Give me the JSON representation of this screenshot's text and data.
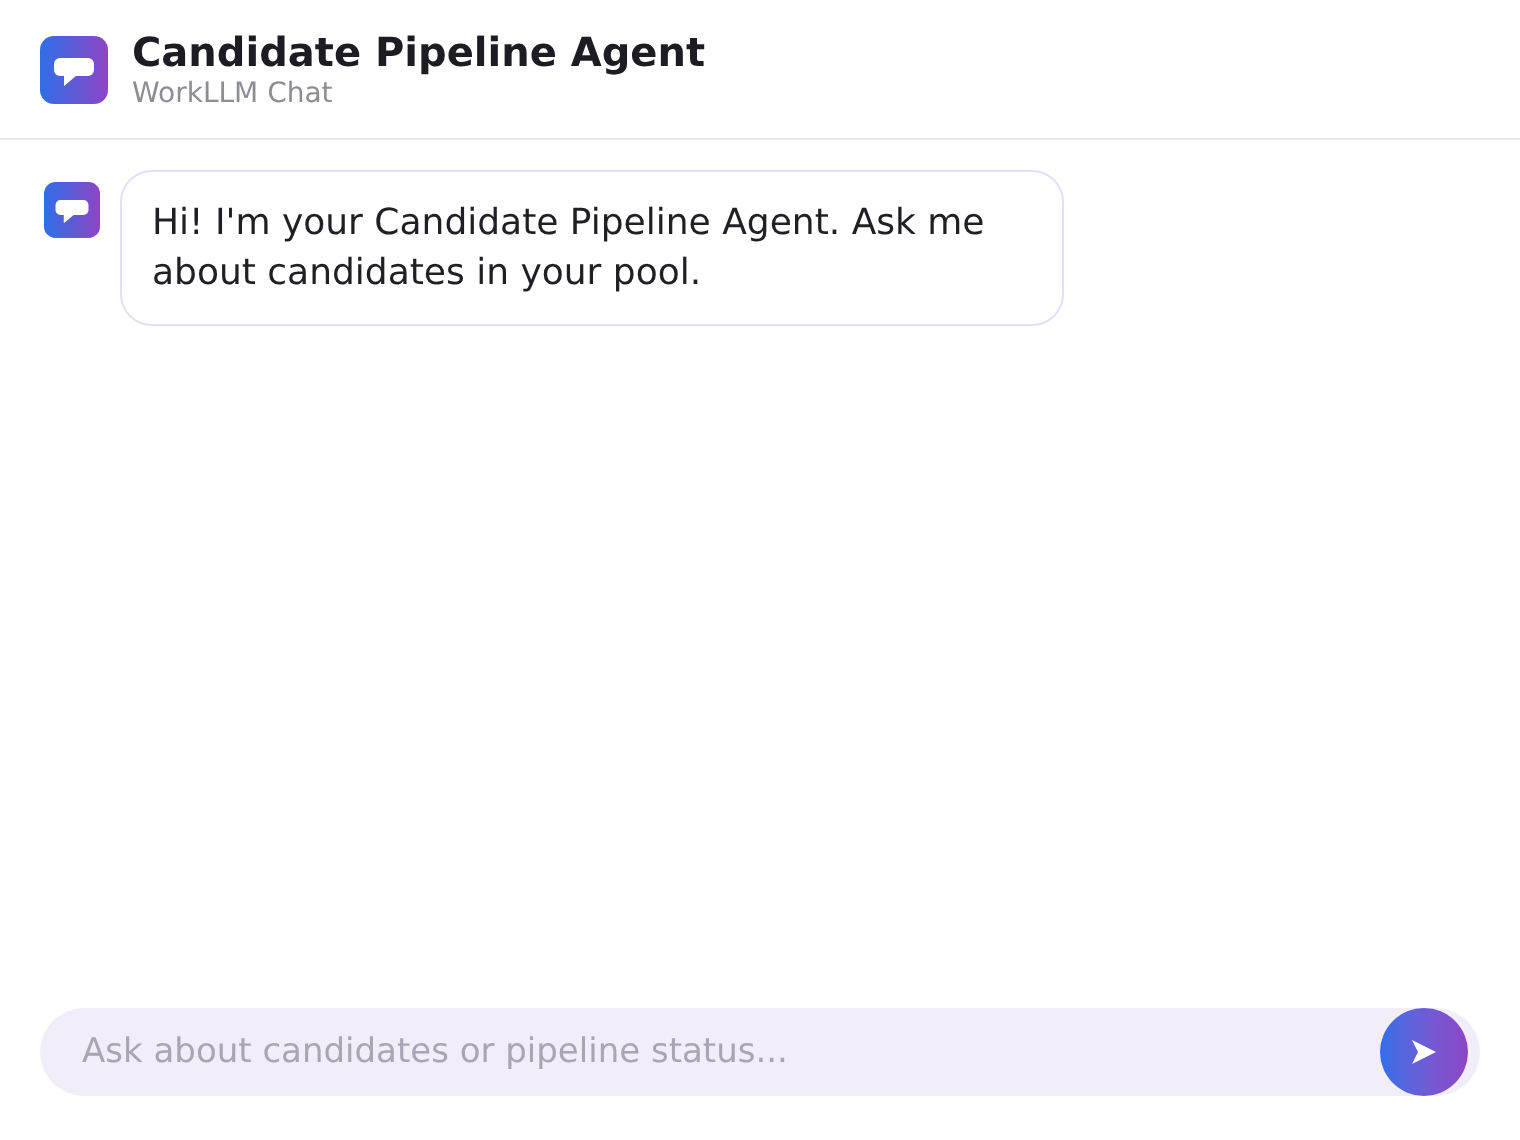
{
  "header": {
    "title": "Candidate Pipeline Agent",
    "subtitle": "WorkLLM Chat"
  },
  "messages": [
    {
      "kind": "agent",
      "text": "Hi! I'm your Candidate Pipeline Agent. Ask me about candidates in your pool."
    }
  ],
  "composer": {
    "placeholder": "Ask about candidates or pipeline status..."
  }
}
